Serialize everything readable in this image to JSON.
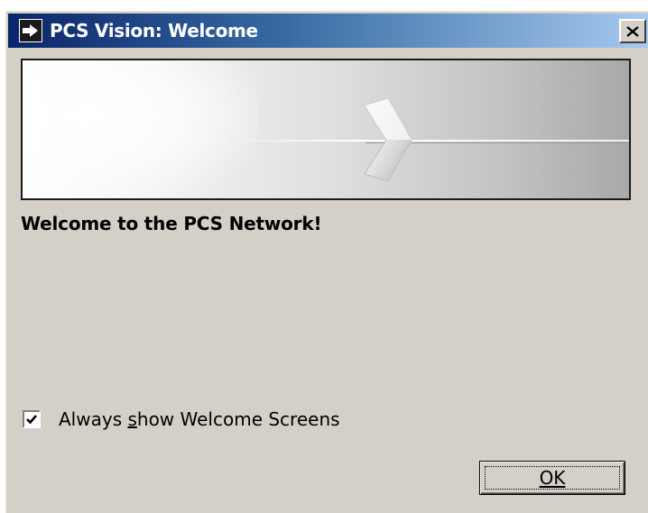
{
  "window": {
    "title": "PCS Vision: Welcome",
    "close_label": "×",
    "app_icon": "app-arrow-icon",
    "close_icon": "close-icon"
  },
  "banner": {
    "image": "welcome-banner-arrow",
    "colors": {
      "light": "#ffffff",
      "dark": "#a8a8a8"
    }
  },
  "content": {
    "heading": "Welcome to the PCS Network!"
  },
  "options": {
    "always_show": {
      "label_prefix": "Always ",
      "label_mnemonic": "s",
      "label_suffix": "how Welcome Screens",
      "checked": true
    }
  },
  "buttons": {
    "ok_label": "OK"
  },
  "colors": {
    "titlebar_start": "#0a246a",
    "titlebar_end": "#a6caf0",
    "dialog_face": "#d4d0c8"
  }
}
